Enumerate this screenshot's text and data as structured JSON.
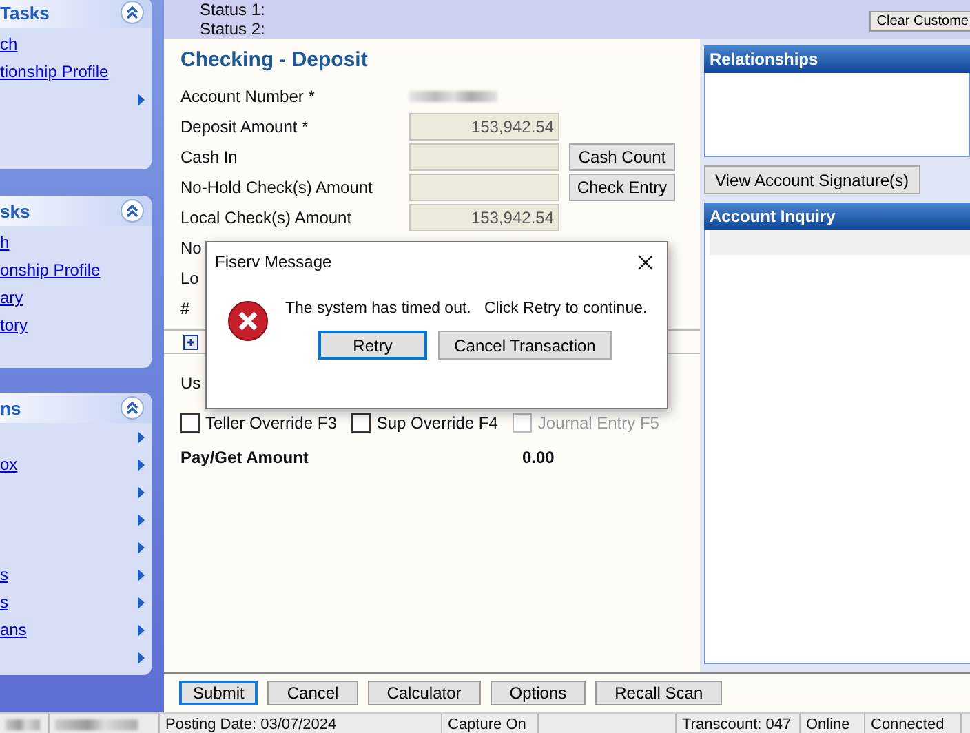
{
  "sidebar": {
    "panels": [
      {
        "title": "Tasks",
        "expanded": true,
        "items": [
          {
            "label": "ch",
            "has_arrow": false
          },
          {
            "label": "tionship Profile",
            "has_arrow": false
          },
          {
            "has_arrow": true
          }
        ]
      },
      {
        "title": "sks",
        "expanded": true,
        "items": [
          {
            "label": "h",
            "has_arrow": false
          },
          {
            "label": "onship Profile",
            "has_arrow": false
          },
          {
            "label": "ary",
            "has_arrow": false
          },
          {
            "label": "tory",
            "has_arrow": false
          }
        ]
      },
      {
        "title": "ns",
        "expanded": true,
        "items": [
          {
            "has_arrow": true
          },
          {
            "label": "ox",
            "has_arrow": true
          },
          {
            "has_arrow": true
          },
          {
            "has_arrow": true
          },
          {
            "has_arrow": true
          },
          {
            "label": "s",
            "has_arrow": true
          },
          {
            "label": "s",
            "has_arrow": true
          },
          {
            "label": "ans",
            "has_arrow": true
          },
          {
            "has_arrow": true
          }
        ]
      }
    ]
  },
  "header": {
    "status_lines": [
      "Status 1:",
      "Status 2:"
    ],
    "button": "Clear Custome"
  },
  "form": {
    "title": "Checking - Deposit",
    "fields": [
      {
        "label": "Account Number *",
        "kind": "masked"
      },
      {
        "label": "Deposit Amount *",
        "kind": "input",
        "value": "153,942.54"
      },
      {
        "label": "Cash In",
        "kind": "input",
        "button": "Cash Count"
      },
      {
        "label": "No-Hold Check(s) Amount",
        "kind": "input",
        "button": "Check Entry"
      },
      {
        "label": "Local Check(s) Amount",
        "kind": "input",
        "value": "153,942.54"
      },
      {
        "label": "No",
        "kind": "label"
      },
      {
        "label": "Lo",
        "kind": "label"
      },
      {
        "label": "#",
        "kind": "label"
      }
    ],
    "lower_label": "Us",
    "checkboxes": [
      {
        "label": "Teller Override F3",
        "checked": false,
        "disabled": false
      },
      {
        "label": "Sup Override F4",
        "checked": false,
        "disabled": false
      },
      {
        "label": "Journal Entry F5",
        "checked": false,
        "disabled": true
      }
    ],
    "total_label": "Pay/Get Amount",
    "total_value": "0.00"
  },
  "right_panel": {
    "relationships_title": "Relationships",
    "signature_button": "View Account Signature(s)",
    "inquiry_title": "Account Inquiry"
  },
  "buttons": [
    {
      "label": "Submit",
      "default": true
    },
    {
      "label": "Cancel",
      "default": false
    },
    {
      "label": "Calculator",
      "default": false
    },
    {
      "label": "Options",
      "default": false
    },
    {
      "label": "Recall Scan",
      "default": false
    }
  ],
  "status_bar": [
    {
      "kind": "masked"
    },
    {
      "kind": "masked"
    },
    {
      "kind": "text",
      "text": "Posting Date: 03/07/2024"
    },
    {
      "kind": "text",
      "text": "Capture On"
    },
    {
      "kind": "empty"
    },
    {
      "kind": "text",
      "text": "Transcount: 047"
    },
    {
      "kind": "text",
      "text": "Online"
    },
    {
      "kind": "text",
      "text": "Connected"
    }
  ],
  "dialog": {
    "title": "Fiserv Message",
    "message": "The system has timed out.   Click Retry to continue.",
    "buttons": [
      {
        "label": "Retry",
        "default": true
      },
      {
        "label": "Cancel Transaction",
        "default": false
      }
    ]
  }
}
